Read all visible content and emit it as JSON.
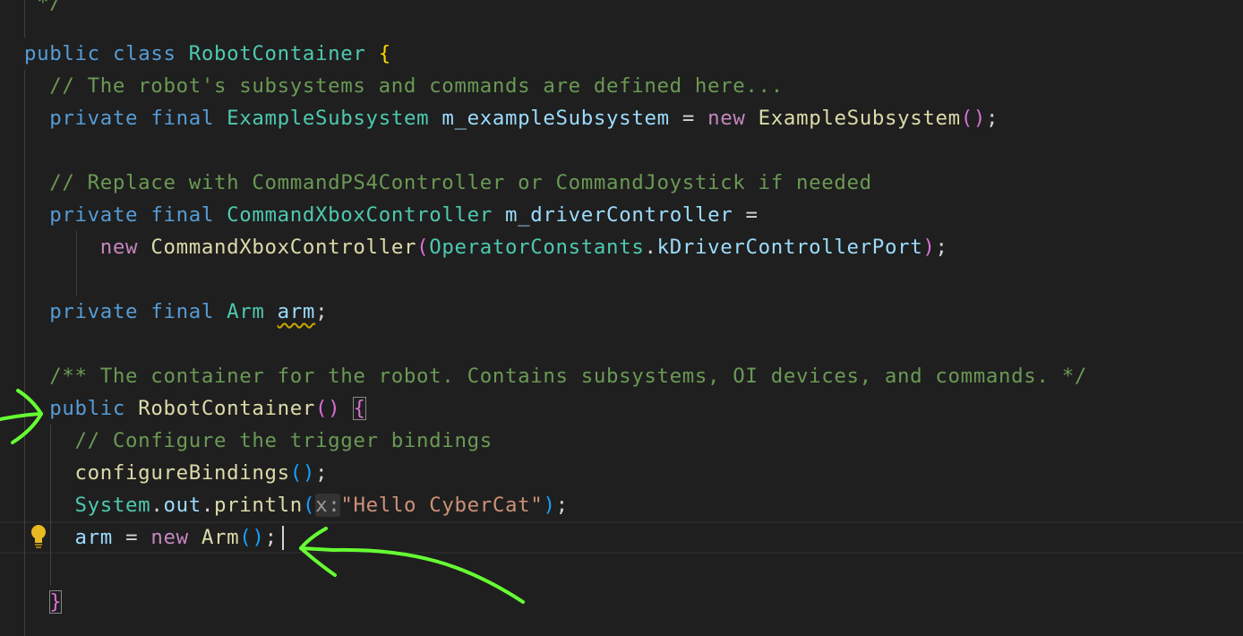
{
  "editor": {
    "lines": [
      {
        "id": "line-comment-end",
        "tokens": [
          [
            "cm",
            " */"
          ]
        ]
      },
      {
        "id": "line-class-decl",
        "tokens": [
          [
            "kw",
            "public"
          ],
          [
            "plain",
            " "
          ],
          [
            "kw",
            "class"
          ],
          [
            "plain",
            " "
          ],
          [
            "ty",
            "RobotContainer"
          ],
          [
            "plain",
            " "
          ],
          [
            "p0",
            "{"
          ]
        ]
      },
      {
        "id": "line-comment-subsystems",
        "tokens": [
          [
            "plain",
            "  "
          ],
          [
            "cm",
            "// The robot's subsystems and commands are defined here..."
          ]
        ]
      },
      {
        "id": "line-example-subsystem",
        "tokens": [
          [
            "plain",
            "  "
          ],
          [
            "kw",
            "private"
          ],
          [
            "plain",
            " "
          ],
          [
            "kw",
            "final"
          ],
          [
            "plain",
            " "
          ],
          [
            "ty",
            "ExampleSubsystem"
          ],
          [
            "plain",
            " "
          ],
          [
            "var",
            "m_exampleSubsystem"
          ],
          [
            "plain",
            " = "
          ],
          [
            "kwc",
            "new"
          ],
          [
            "plain",
            " "
          ],
          [
            "fn",
            "ExampleSubsystem"
          ],
          [
            "p1",
            "()"
          ],
          [
            "plain",
            ";"
          ]
        ]
      },
      {
        "id": "line-blank-1",
        "tokens": []
      },
      {
        "id": "line-comment-replace",
        "tokens": [
          [
            "plain",
            "  "
          ],
          [
            "cm",
            "// Replace with CommandPS4Controller or CommandJoystick if needed"
          ]
        ]
      },
      {
        "id": "line-driver-controller",
        "tokens": [
          [
            "plain",
            "  "
          ],
          [
            "kw",
            "private"
          ],
          [
            "plain",
            " "
          ],
          [
            "kw",
            "final"
          ],
          [
            "plain",
            " "
          ],
          [
            "ty",
            "CommandXboxController"
          ],
          [
            "plain",
            " "
          ],
          [
            "var",
            "m_driverController"
          ],
          [
            "plain",
            " ="
          ]
        ]
      },
      {
        "id": "line-new-controller",
        "tokens": [
          [
            "plain",
            "      "
          ],
          [
            "kwc",
            "new"
          ],
          [
            "plain",
            " "
          ],
          [
            "fn",
            "CommandXboxController"
          ],
          [
            "p1",
            "("
          ],
          [
            "ty",
            "OperatorConstants"
          ],
          [
            "plain",
            "."
          ],
          [
            "var",
            "kDriverControllerPort"
          ],
          [
            "p1",
            ")"
          ],
          [
            "plain",
            ";"
          ]
        ]
      },
      {
        "id": "line-blank-2",
        "tokens": []
      },
      {
        "id": "line-arm-field",
        "tokens": [
          [
            "plain",
            "  "
          ],
          [
            "kw",
            "private"
          ],
          [
            "plain",
            " "
          ],
          [
            "kw",
            "final"
          ],
          [
            "plain",
            " "
          ],
          [
            "ty",
            "Arm"
          ],
          [
            "plain",
            " "
          ],
          [
            "var squiggle",
            "arm"
          ],
          [
            "plain",
            ";"
          ]
        ]
      },
      {
        "id": "line-blank-3",
        "tokens": []
      },
      {
        "id": "line-javadoc",
        "tokens": [
          [
            "plain",
            "  "
          ],
          [
            "cm",
            "/** The container for the robot. Contains subsystems, OI devices, and commands. */"
          ]
        ]
      },
      {
        "id": "line-constructor",
        "tokens": [
          [
            "plain",
            "  "
          ],
          [
            "kw",
            "public"
          ],
          [
            "plain",
            " "
          ],
          [
            "fn",
            "RobotContainer"
          ],
          [
            "p1",
            "()"
          ],
          [
            "plain",
            " "
          ],
          [
            "p1 bracket-box",
            "{"
          ]
        ]
      },
      {
        "id": "line-comment-configure",
        "tokens": [
          [
            "plain",
            "    "
          ],
          [
            "cm",
            "// Configure the trigger bindings"
          ]
        ]
      },
      {
        "id": "line-configure-call",
        "tokens": [
          [
            "plain",
            "    "
          ],
          [
            "fn",
            "configureBindings"
          ],
          [
            "p2",
            "()"
          ],
          [
            "plain",
            ";"
          ]
        ]
      },
      {
        "id": "line-println",
        "tokens": [
          [
            "plain",
            "    "
          ],
          [
            "ty",
            "System"
          ],
          [
            "plain",
            "."
          ],
          [
            "var",
            "out"
          ],
          [
            "plain",
            "."
          ],
          [
            "fn",
            "println"
          ],
          [
            "p2",
            "("
          ],
          [
            "hint",
            "x:"
          ],
          [
            "str",
            "\"Hello CyberCat\""
          ],
          [
            "p2",
            ")"
          ],
          [
            "plain",
            ";"
          ]
        ]
      },
      {
        "id": "line-arm-assign",
        "tokens": [
          [
            "plain",
            "    "
          ],
          [
            "var",
            "arm"
          ],
          [
            "plain",
            " = "
          ],
          [
            "kwc",
            "new"
          ],
          [
            "plain",
            " "
          ],
          [
            "fn",
            "Arm"
          ],
          [
            "p2",
            "()"
          ],
          [
            "plain",
            ";"
          ]
        ]
      },
      {
        "id": "line-blank-4",
        "tokens": []
      },
      {
        "id": "line-close-brace",
        "tokens": [
          [
            "plain",
            "  "
          ],
          [
            "p1 bracket-box",
            "}"
          ]
        ]
      }
    ],
    "colors": {
      "background": "#1f1f1f",
      "keyword": "#569cd6",
      "control_keyword": "#c586c0",
      "type": "#4ec9b0",
      "function": "#dcdcaa",
      "variable": "#9cdcfe",
      "comment": "#6a9955",
      "string": "#ce9178",
      "annotation_ink": "#66ff33",
      "lightbulb": "#e8b923"
    },
    "gutter": {
      "lightbulb_icon": "lightbulb-icon"
    },
    "annotations": {
      "arrows": [
        "green-arrow-constructor",
        "green-arrow-arm-assign"
      ]
    }
  }
}
